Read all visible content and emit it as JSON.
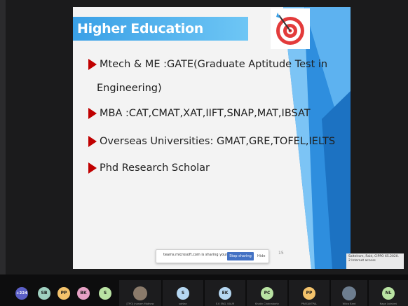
{
  "slide": {
    "title": "Higher Education",
    "bullets": [
      {
        "line1": "Mtech & ME  :GATE(Graduate Aptitude Test in",
        "line2": "Engineering)"
      },
      {
        "line1": "MBA  :CAT,CMAT,XAT,IIFT,SNAP,MAT,IBSAT"
      },
      {
        "line1": "Overseas Universities: GMAT,GRE,TOFEL,IELTS"
      },
      {
        "line1": "Phd Research Scholar"
      }
    ],
    "slide_number": "15"
  },
  "share_bar": {
    "message": "teams.microsoft.com is sharing your screen.",
    "stop_label": "Stop sharing",
    "hide_label": "Hide"
  },
  "notification": {
    "text": "Saltelrom, Raid, CIPPO 65.2020. 2 Internet access"
  },
  "participants": {
    "overflow_count": "+224",
    "avatars": [
      {
        "initials": "SB",
        "color": "#9fd0c0"
      },
      {
        "initials": "PP",
        "color": "#f3c26b"
      },
      {
        "initials": "BK",
        "color": "#e6a0c4"
      },
      {
        "initials": "S",
        "color": "#b9e3a3"
      }
    ],
    "tiles": [
      {
        "initials": "",
        "name": "[TPO] Jnanam Mathew",
        "photo": true
      },
      {
        "initials": "S",
        "name": "sahlan",
        "color": "#b5d7f2"
      },
      {
        "initials": "EK",
        "name": "E.K ENG. KAUR",
        "color": "#b5d7f2"
      },
      {
        "initials": "PC",
        "name": "Khatin Chakraborty",
        "color": "#b9e3a3"
      },
      {
        "initials": "PP",
        "name": "PRASANTPAL",
        "color": "#f3c26b"
      },
      {
        "initials": "",
        "name": "Wilca Bard",
        "photo": true
      },
      {
        "initials": "NL",
        "name": "Naga Lakshmi",
        "color": "#b9e3a3"
      }
    ]
  }
}
